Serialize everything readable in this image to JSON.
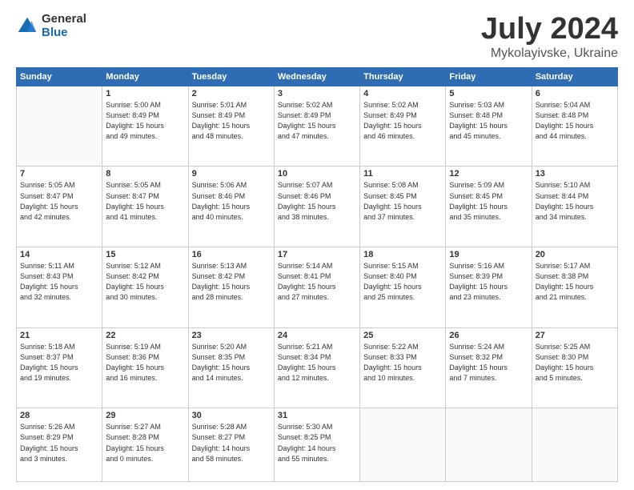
{
  "logo": {
    "general": "General",
    "blue": "Blue"
  },
  "title": {
    "month_year": "July 2024",
    "location": "Mykolayivske, Ukraine"
  },
  "weekdays": [
    "Sunday",
    "Monday",
    "Tuesday",
    "Wednesday",
    "Thursday",
    "Friday",
    "Saturday"
  ],
  "weeks": [
    [
      {
        "day": "",
        "sunrise": "",
        "sunset": "",
        "daylight": ""
      },
      {
        "day": "1",
        "sunrise": "Sunrise: 5:00 AM",
        "sunset": "Sunset: 8:49 PM",
        "daylight": "Daylight: 15 hours and 49 minutes."
      },
      {
        "day": "2",
        "sunrise": "Sunrise: 5:01 AM",
        "sunset": "Sunset: 8:49 PM",
        "daylight": "Daylight: 15 hours and 48 minutes."
      },
      {
        "day": "3",
        "sunrise": "Sunrise: 5:02 AM",
        "sunset": "Sunset: 8:49 PM",
        "daylight": "Daylight: 15 hours and 47 minutes."
      },
      {
        "day": "4",
        "sunrise": "Sunrise: 5:02 AM",
        "sunset": "Sunset: 8:49 PM",
        "daylight": "Daylight: 15 hours and 46 minutes."
      },
      {
        "day": "5",
        "sunrise": "Sunrise: 5:03 AM",
        "sunset": "Sunset: 8:48 PM",
        "daylight": "Daylight: 15 hours and 45 minutes."
      },
      {
        "day": "6",
        "sunrise": "Sunrise: 5:04 AM",
        "sunset": "Sunset: 8:48 PM",
        "daylight": "Daylight: 15 hours and 44 minutes."
      }
    ],
    [
      {
        "day": "7",
        "sunrise": "Sunrise: 5:05 AM",
        "sunset": "Sunset: 8:47 PM",
        "daylight": "Daylight: 15 hours and 42 minutes."
      },
      {
        "day": "8",
        "sunrise": "Sunrise: 5:05 AM",
        "sunset": "Sunset: 8:47 PM",
        "daylight": "Daylight: 15 hours and 41 minutes."
      },
      {
        "day": "9",
        "sunrise": "Sunrise: 5:06 AM",
        "sunset": "Sunset: 8:46 PM",
        "daylight": "Daylight: 15 hours and 40 minutes."
      },
      {
        "day": "10",
        "sunrise": "Sunrise: 5:07 AM",
        "sunset": "Sunset: 8:46 PM",
        "daylight": "Daylight: 15 hours and 38 minutes."
      },
      {
        "day": "11",
        "sunrise": "Sunrise: 5:08 AM",
        "sunset": "Sunset: 8:45 PM",
        "daylight": "Daylight: 15 hours and 37 minutes."
      },
      {
        "day": "12",
        "sunrise": "Sunrise: 5:09 AM",
        "sunset": "Sunset: 8:45 PM",
        "daylight": "Daylight: 15 hours and 35 minutes."
      },
      {
        "day": "13",
        "sunrise": "Sunrise: 5:10 AM",
        "sunset": "Sunset: 8:44 PM",
        "daylight": "Daylight: 15 hours and 34 minutes."
      }
    ],
    [
      {
        "day": "14",
        "sunrise": "Sunrise: 5:11 AM",
        "sunset": "Sunset: 8:43 PM",
        "daylight": "Daylight: 15 hours and 32 minutes."
      },
      {
        "day": "15",
        "sunrise": "Sunrise: 5:12 AM",
        "sunset": "Sunset: 8:42 PM",
        "daylight": "Daylight: 15 hours and 30 minutes."
      },
      {
        "day": "16",
        "sunrise": "Sunrise: 5:13 AM",
        "sunset": "Sunset: 8:42 PM",
        "daylight": "Daylight: 15 hours and 28 minutes."
      },
      {
        "day": "17",
        "sunrise": "Sunrise: 5:14 AM",
        "sunset": "Sunset: 8:41 PM",
        "daylight": "Daylight: 15 hours and 27 minutes."
      },
      {
        "day": "18",
        "sunrise": "Sunrise: 5:15 AM",
        "sunset": "Sunset: 8:40 PM",
        "daylight": "Daylight: 15 hours and 25 minutes."
      },
      {
        "day": "19",
        "sunrise": "Sunrise: 5:16 AM",
        "sunset": "Sunset: 8:39 PM",
        "daylight": "Daylight: 15 hours and 23 minutes."
      },
      {
        "day": "20",
        "sunrise": "Sunrise: 5:17 AM",
        "sunset": "Sunset: 8:38 PM",
        "daylight": "Daylight: 15 hours and 21 minutes."
      }
    ],
    [
      {
        "day": "21",
        "sunrise": "Sunrise: 5:18 AM",
        "sunset": "Sunset: 8:37 PM",
        "daylight": "Daylight: 15 hours and 19 minutes."
      },
      {
        "day": "22",
        "sunrise": "Sunrise: 5:19 AM",
        "sunset": "Sunset: 8:36 PM",
        "daylight": "Daylight: 15 hours and 16 minutes."
      },
      {
        "day": "23",
        "sunrise": "Sunrise: 5:20 AM",
        "sunset": "Sunset: 8:35 PM",
        "daylight": "Daylight: 15 hours and 14 minutes."
      },
      {
        "day": "24",
        "sunrise": "Sunrise: 5:21 AM",
        "sunset": "Sunset: 8:34 PM",
        "daylight": "Daylight: 15 hours and 12 minutes."
      },
      {
        "day": "25",
        "sunrise": "Sunrise: 5:22 AM",
        "sunset": "Sunset: 8:33 PM",
        "daylight": "Daylight: 15 hours and 10 minutes."
      },
      {
        "day": "26",
        "sunrise": "Sunrise: 5:24 AM",
        "sunset": "Sunset: 8:32 PM",
        "daylight": "Daylight: 15 hours and 7 minutes."
      },
      {
        "day": "27",
        "sunrise": "Sunrise: 5:25 AM",
        "sunset": "Sunset: 8:30 PM",
        "daylight": "Daylight: 15 hours and 5 minutes."
      }
    ],
    [
      {
        "day": "28",
        "sunrise": "Sunrise: 5:26 AM",
        "sunset": "Sunset: 8:29 PM",
        "daylight": "Daylight: 15 hours and 3 minutes."
      },
      {
        "day": "29",
        "sunrise": "Sunrise: 5:27 AM",
        "sunset": "Sunset: 8:28 PM",
        "daylight": "Daylight: 15 hours and 0 minutes."
      },
      {
        "day": "30",
        "sunrise": "Sunrise: 5:28 AM",
        "sunset": "Sunset: 8:27 PM",
        "daylight": "Daylight: 14 hours and 58 minutes."
      },
      {
        "day": "31",
        "sunrise": "Sunrise: 5:30 AM",
        "sunset": "Sunset: 8:25 PM",
        "daylight": "Daylight: 14 hours and 55 minutes."
      },
      {
        "day": "",
        "sunrise": "",
        "sunset": "",
        "daylight": ""
      },
      {
        "day": "",
        "sunrise": "",
        "sunset": "",
        "daylight": ""
      },
      {
        "day": "",
        "sunrise": "",
        "sunset": "",
        "daylight": ""
      }
    ]
  ]
}
